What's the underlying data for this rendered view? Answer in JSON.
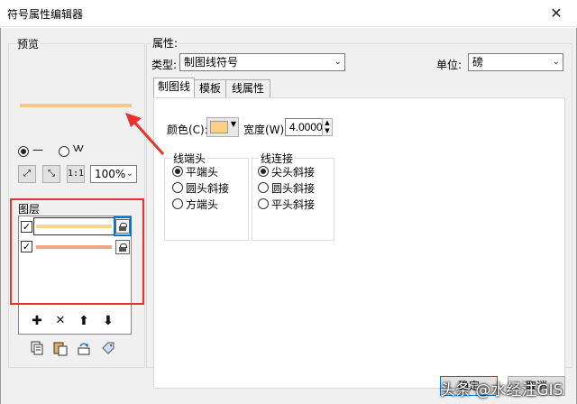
{
  "window": {
    "title": "符号属性编辑器",
    "close": "✕"
  },
  "preview": {
    "label": "预览",
    "line_color": "#f6c98a",
    "mode_line": "—",
    "mode_wave": "VV",
    "zoom": "100%",
    "btn_fit": "⤢",
    "btn_expand": "⤡",
    "btn_actual": "1:1"
  },
  "layers": {
    "label": "图层",
    "items": [
      {
        "checked": "✓",
        "color": "#fad78a"
      },
      {
        "checked": "✓",
        "color": "#f4a583"
      }
    ],
    "add": "✚",
    "delete": "✕",
    "up": "⬆",
    "down": "⬇"
  },
  "properties": {
    "label": "属性:",
    "type_label": "类型:",
    "type_value": "制图线符号",
    "unit_label": "单位:",
    "unit_value": "磅",
    "tabs": [
      "制图线",
      "模板",
      "线属性"
    ],
    "color_label": "颜色(C):",
    "color_value": "#fbd086",
    "width_label": "宽度(W):",
    "width_value": "4.0000",
    "spin_up": "▲",
    "spin_down": "▼",
    "caps": {
      "label": "线端头",
      "options": [
        "平端头",
        "圆头斜接",
        "方端头"
      ],
      "selected": 0
    },
    "joins": {
      "label": "线连接",
      "options": [
        "尖头斜接",
        "圆头斜接",
        "平头斜接"
      ],
      "selected": 0
    }
  },
  "footer": {
    "ok": "确定",
    "cancel": "取消"
  },
  "watermark": "头条 @水经注GIS",
  "annotation": {
    "arrow_color": "#e8332a"
  },
  "dropdown_arrow": "⌄"
}
